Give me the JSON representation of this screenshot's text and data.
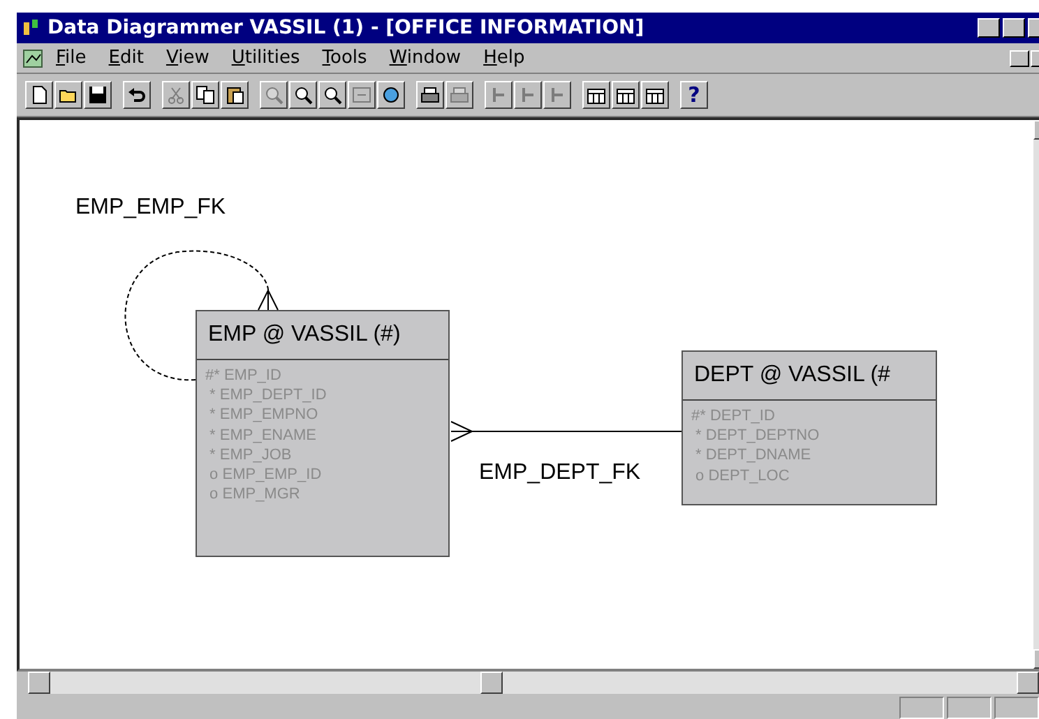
{
  "window": {
    "title": "Data Diagrammer VASSIL (1) - [OFFICE INFORMATION]"
  },
  "menu": [
    "File",
    "Edit",
    "View",
    "Utilities",
    "Tools",
    "Window",
    "Help"
  ],
  "toolbar": [
    [
      {
        "kind": "new",
        "disabled": false
      },
      {
        "kind": "open",
        "disabled": false
      },
      {
        "kind": "save",
        "disabled": false
      }
    ],
    [
      {
        "kind": "undo",
        "disabled": false
      }
    ],
    [
      {
        "kind": "cut",
        "disabled": true
      },
      {
        "kind": "copy",
        "disabled": false
      },
      {
        "kind": "paste",
        "disabled": false
      }
    ],
    [
      {
        "kind": "zoom",
        "disabled": true
      },
      {
        "kind": "zoom",
        "disabled": false
      },
      {
        "kind": "zoom",
        "disabled": false
      },
      {
        "kind": "fit",
        "disabled": true
      },
      {
        "kind": "refresh",
        "disabled": false
      }
    ],
    [
      {
        "kind": "print",
        "disabled": false
      },
      {
        "kind": "print",
        "disabled": true
      }
    ],
    [
      {
        "kind": "key",
        "disabled": true
      },
      {
        "kind": "key",
        "disabled": true
      },
      {
        "kind": "key",
        "disabled": true
      }
    ],
    [
      {
        "kind": "table",
        "disabled": false
      },
      {
        "kind": "table",
        "disabled": false
      },
      {
        "kind": "table",
        "disabled": false
      }
    ],
    [
      {
        "kind": "help",
        "label": "?",
        "disabled": false
      }
    ]
  ],
  "diagram": {
    "entities": [
      {
        "title": "EMP @ VASSIL (#)",
        "columns": [
          "#* EMP_ID",
          " * EMP_DEPT_ID",
          " * EMP_EMPNO",
          " * EMP_ENAME",
          " * EMP_JOB",
          " o EMP_EMP_ID",
          " o EMP_MGR"
        ]
      },
      {
        "title": "DEPT @ VASSIL (#",
        "columns": [
          "#* DEPT_ID",
          " * DEPT_DEPTNO",
          " * DEPT_DNAME",
          " o DEPT_LOC"
        ]
      }
    ],
    "relationships": [
      {
        "label": "EMP_EMP_FK",
        "kind": "self"
      },
      {
        "label": "EMP_DEPT_FK",
        "kind": "link"
      }
    ]
  }
}
